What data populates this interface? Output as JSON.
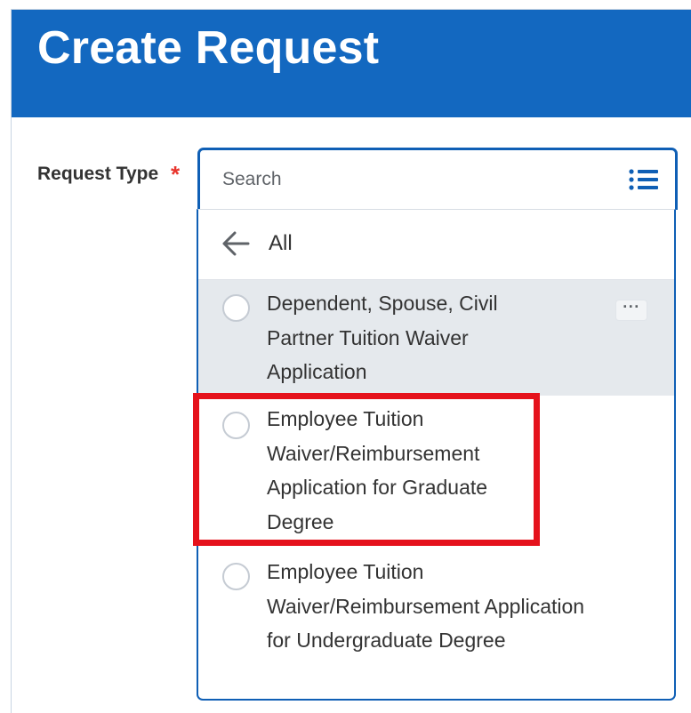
{
  "header": {
    "title": "Create Request",
    "background": "#1368c0"
  },
  "form": {
    "request_type": {
      "label": "Request Type",
      "required_marker": "*",
      "search_placeholder": "Search",
      "prompt_icon": "list-icon"
    }
  },
  "dropdown": {
    "back_icon": "arrow-left-icon",
    "category_label": "All",
    "options": [
      {
        "label": "Dependent, Spouse, Civil Partner Tuition Waiver Application",
        "related_actions": "···"
      },
      {
        "label": "Employee Tuition Waiver/Reimbursement Application for Graduate Degree"
      },
      {
        "label": "Employee Tuition Waiver/Reimbursement Application for Undergraduate Degree"
      }
    ]
  },
  "annotation": {
    "color": "#e5121c"
  },
  "colors": {
    "accent": "#0f5fb5",
    "required": "#e8352d",
    "highlight_row": "#e5e9ed"
  }
}
